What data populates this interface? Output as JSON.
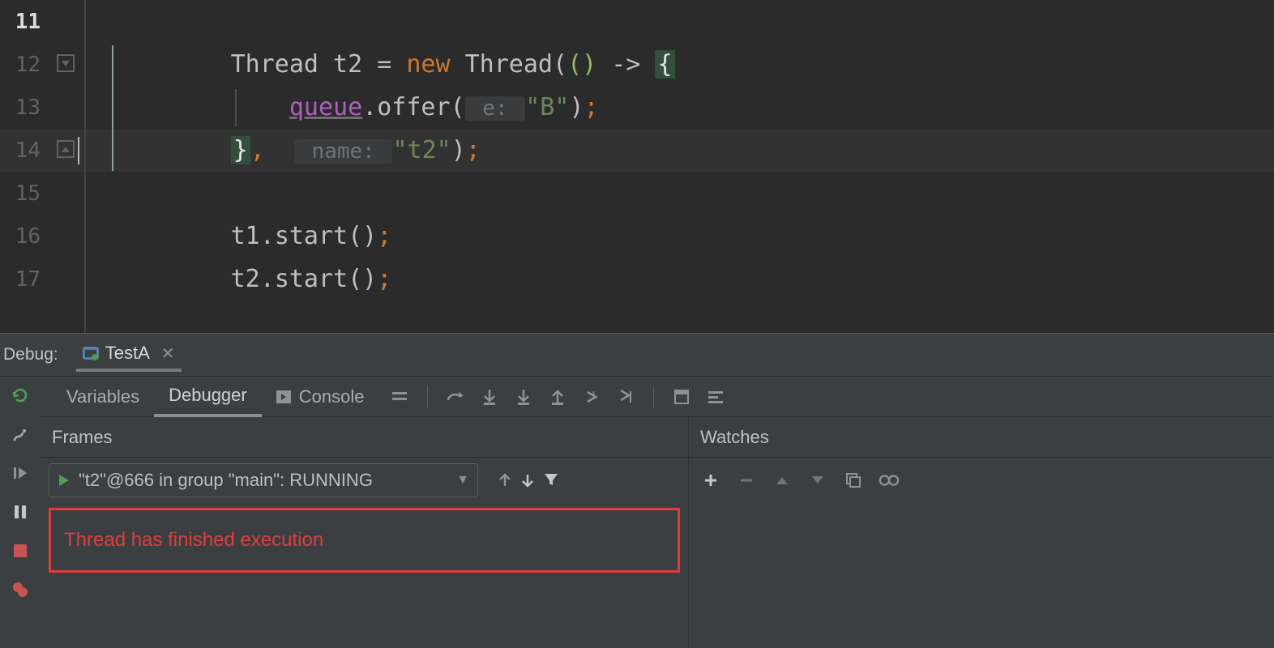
{
  "editor": {
    "lines": {
      "n11": "11",
      "n12": "12",
      "n13": "13",
      "n14": "14",
      "n15": "15",
      "n16": "16",
      "n17": "17"
    },
    "l12_thread": "Thread",
    "l12_var": " t2 ",
    "l12_eq": "= ",
    "l12_new": "new",
    "l12_thread2": " Thread",
    "l12_lp": "(",
    "l12_lambda_lp": "(",
    "l12_lambda_rp": ")",
    "l12_arrow": " -> ",
    "l12_brace": "{",
    "l13_queue": "queue",
    "l13_dot": ".",
    "l13_offer": "offer",
    "l13_lp": "(",
    "l13_hint": " e: ",
    "l13_str": "\"B\"",
    "l13_rp": ")",
    "l13_sc": ";",
    "l14_brace": "}",
    "l14_comma": ",  ",
    "l14_hint": " name: ",
    "l14_str": "\"t2\"",
    "l14_rp": ")",
    "l14_sc": ";",
    "l16_t1": "t1.",
    "l16_start": "start",
    "l16_paren": "()",
    "l16_sc": ";",
    "l17_t2": "t2.",
    "l17_start": "start",
    "l17_paren": "()",
    "l17_sc": ";"
  },
  "debug": {
    "header_label": "Debug:",
    "tab_title": "TestA",
    "subtabs": {
      "variables": "Variables",
      "debugger": "Debugger",
      "console": "Console"
    },
    "frames_title": "Frames",
    "watches_title": "Watches",
    "thread_selector": "\"t2\"@666 in group \"main\": RUNNING",
    "frames_msg": "Thread has finished execution"
  }
}
